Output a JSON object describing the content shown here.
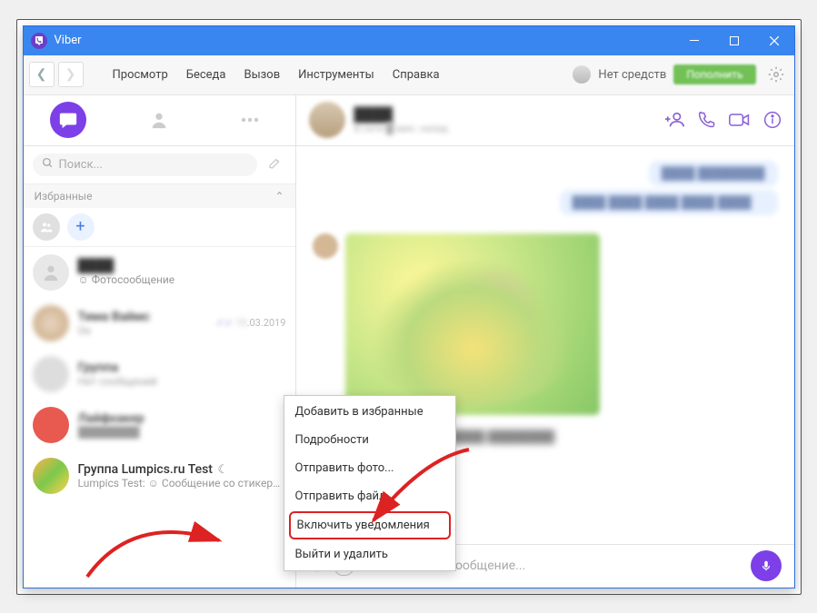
{
  "titlebar": {
    "app": "Viber"
  },
  "menu": {
    "items": [
      "Просмотр",
      "Беседа",
      "Вызов",
      "Инструменты",
      "Справка"
    ],
    "no_funds": "Нет средств",
    "topup": "Пополнить"
  },
  "sidebar": {
    "search_placeholder": "Поиск...",
    "favorites_label": "Избранные",
    "chats": [
      {
        "name": "",
        "sub": "Фотосообщение",
        "date": ""
      },
      {
        "name": "████",
        "sub": "██",
        "date": "██.03.2019"
      },
      {
        "name": "████",
        "sub": "Нет сообщений",
        "date": ""
      },
      {
        "name": "████",
        "sub": "████",
        "date": ""
      },
      {
        "name": "Группа Lumpics.ru Test",
        "sub": "Lumpics Test: ☺ Сообщение со стикером",
        "date": ""
      }
    ]
  },
  "chat": {
    "header_name": "████",
    "header_sub": "В сети █ мин. назад",
    "input_placeholder": "Написать сообщение..."
  },
  "context_menu": {
    "items": [
      "Добавить в избранные",
      "Подробности",
      "Отправить фото...",
      "Отправить файл...",
      "Включить уведомления",
      "Выйти и удалить"
    ]
  }
}
